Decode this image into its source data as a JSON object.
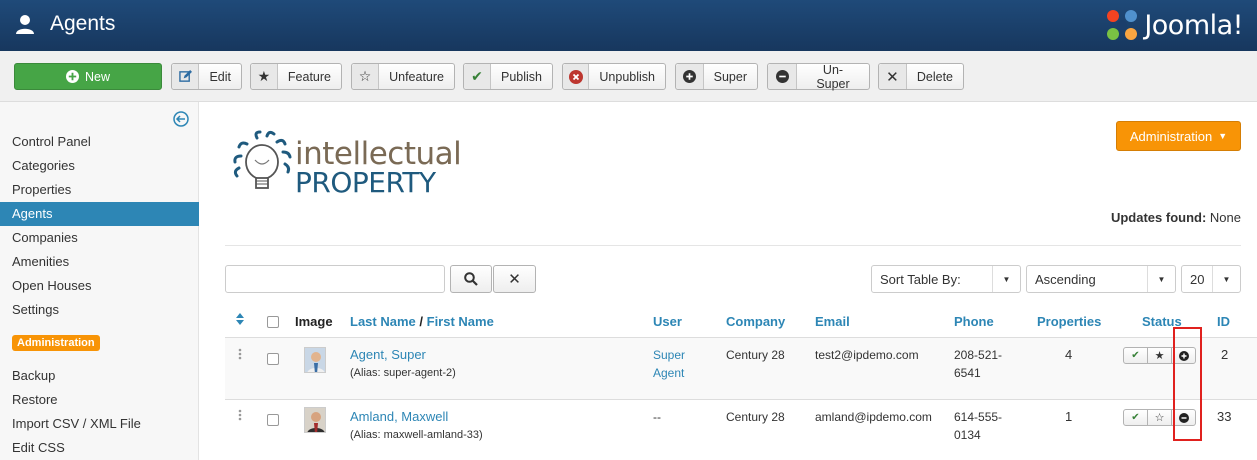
{
  "header": {
    "title": "Agents",
    "brand": "Joomla!"
  },
  "toolbar": {
    "new": "New",
    "edit": "Edit",
    "feature": "Feature",
    "unfeature": "Unfeature",
    "publish": "Publish",
    "unpublish": "Unpublish",
    "super": "Super",
    "unsuper": "Un-Super",
    "delete": "Delete"
  },
  "sidebar": {
    "items": [
      "Control Panel",
      "Categories",
      "Properties",
      "Agents",
      "Companies",
      "Amenities",
      "Open Houses",
      "Settings"
    ],
    "section_badge": "Administration",
    "admin_items": [
      "Backup",
      "Restore",
      "Import CSV / XML File",
      "Edit CSS"
    ]
  },
  "main": {
    "logo_text_1": "intellectual",
    "logo_text_2": "PROPERTY",
    "admin_button": "Administration",
    "updates_label": "Updates found:",
    "updates_value": "None",
    "search_value": "",
    "sort_by": "Sort Table By:",
    "order": "Ascending",
    "limit": "20"
  },
  "table": {
    "headers": {
      "image": "Image",
      "last": "Last Name",
      "slash": "/",
      "first": "First Name",
      "user": "User",
      "company": "Company",
      "email": "Email",
      "phone": "Phone",
      "properties": "Properties",
      "status": "Status",
      "id": "ID"
    },
    "rows": [
      {
        "name": "Agent, Super",
        "alias": "(Alias: super-agent-2)",
        "user1": "Super",
        "user2": "Agent",
        "company": "Century 28",
        "email": "test2@ipdemo.com",
        "phone1": "208-521-",
        "phone2": "6541",
        "properties": "4",
        "id": "2"
      },
      {
        "name": "Amland, Maxwell",
        "alias": "(Alias: maxwell-amland-33)",
        "user1": "--",
        "user2": "",
        "company": "Century 28",
        "email": "amland@ipdemo.com",
        "phone1": "614-555-",
        "phone2": "0134",
        "properties": "1",
        "id": "33"
      }
    ]
  },
  "colors": {
    "header": "#1b3e6b",
    "active": "#2d86b5",
    "new_button": "#46a546",
    "admin": "#f89406",
    "highlight": "#e0211e"
  }
}
